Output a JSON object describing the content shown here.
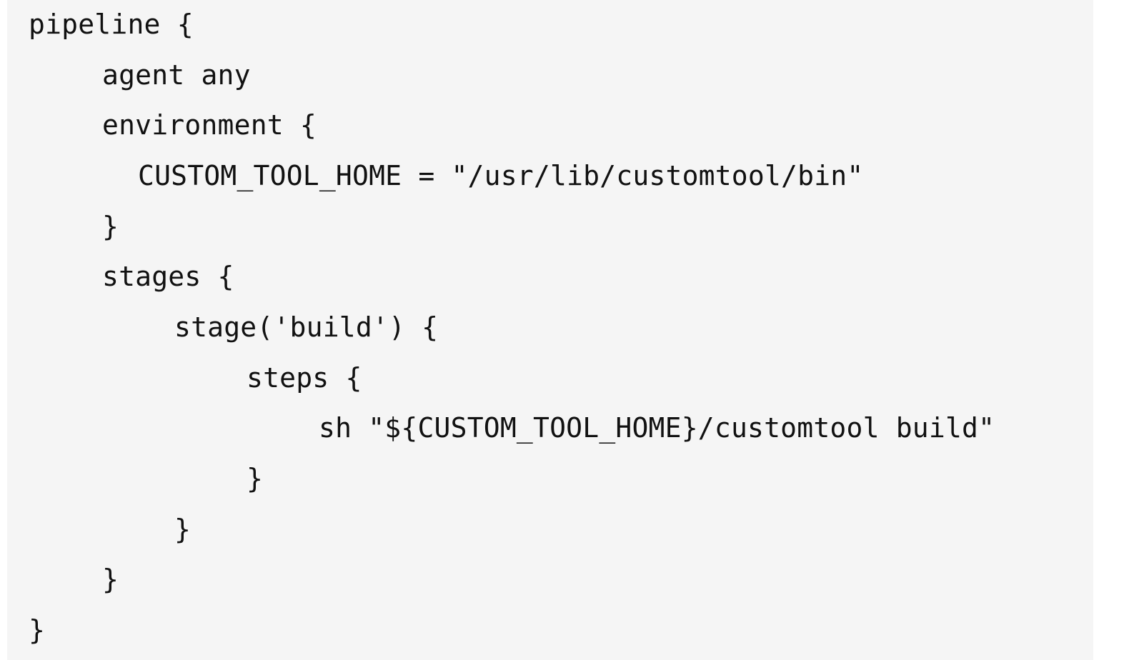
{
  "code": {
    "language": "groovy",
    "lines": [
      {
        "text": "pipeline {"
      },
      {
        "text": "agent any"
      },
      {
        "text": "environment {"
      },
      {
        "text": "CUSTOM_TOOL_HOME = \"/usr/lib/customtool/bin\""
      },
      {
        "text": "}"
      },
      {
        "text": "stages {"
      },
      {
        "text": "stage('build') {"
      },
      {
        "text": "steps {"
      },
      {
        "text": "sh \"${CUSTOM_TOOL_HOME}/customtool build\""
      },
      {
        "text": "}"
      },
      {
        "text": "}"
      },
      {
        "text": "}"
      },
      {
        "text": "}"
      }
    ]
  }
}
